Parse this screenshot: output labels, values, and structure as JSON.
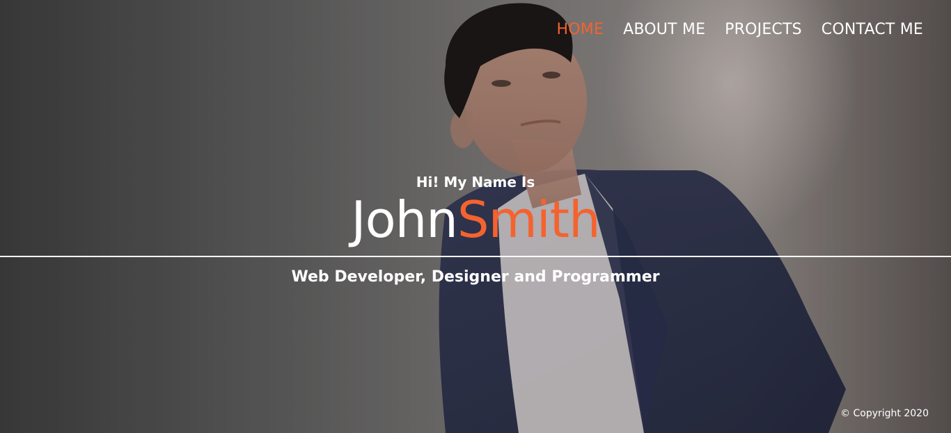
{
  "nav": {
    "items": [
      {
        "label": "HOME",
        "active": true
      },
      {
        "label": "ABOUT ME",
        "active": false
      },
      {
        "label": "PROJECTS",
        "active": false
      },
      {
        "label": "CONTACT ME",
        "active": false
      }
    ]
  },
  "hero": {
    "intro": "Hi! My Name Is",
    "first_name": "John",
    "last_name": "Smith",
    "subtitle": "Web Developer, Designer and Programmer"
  },
  "footer": {
    "copyright": "© Copyright 2020"
  },
  "colors": {
    "accent": "#f4632f",
    "text": "#ffffff"
  }
}
